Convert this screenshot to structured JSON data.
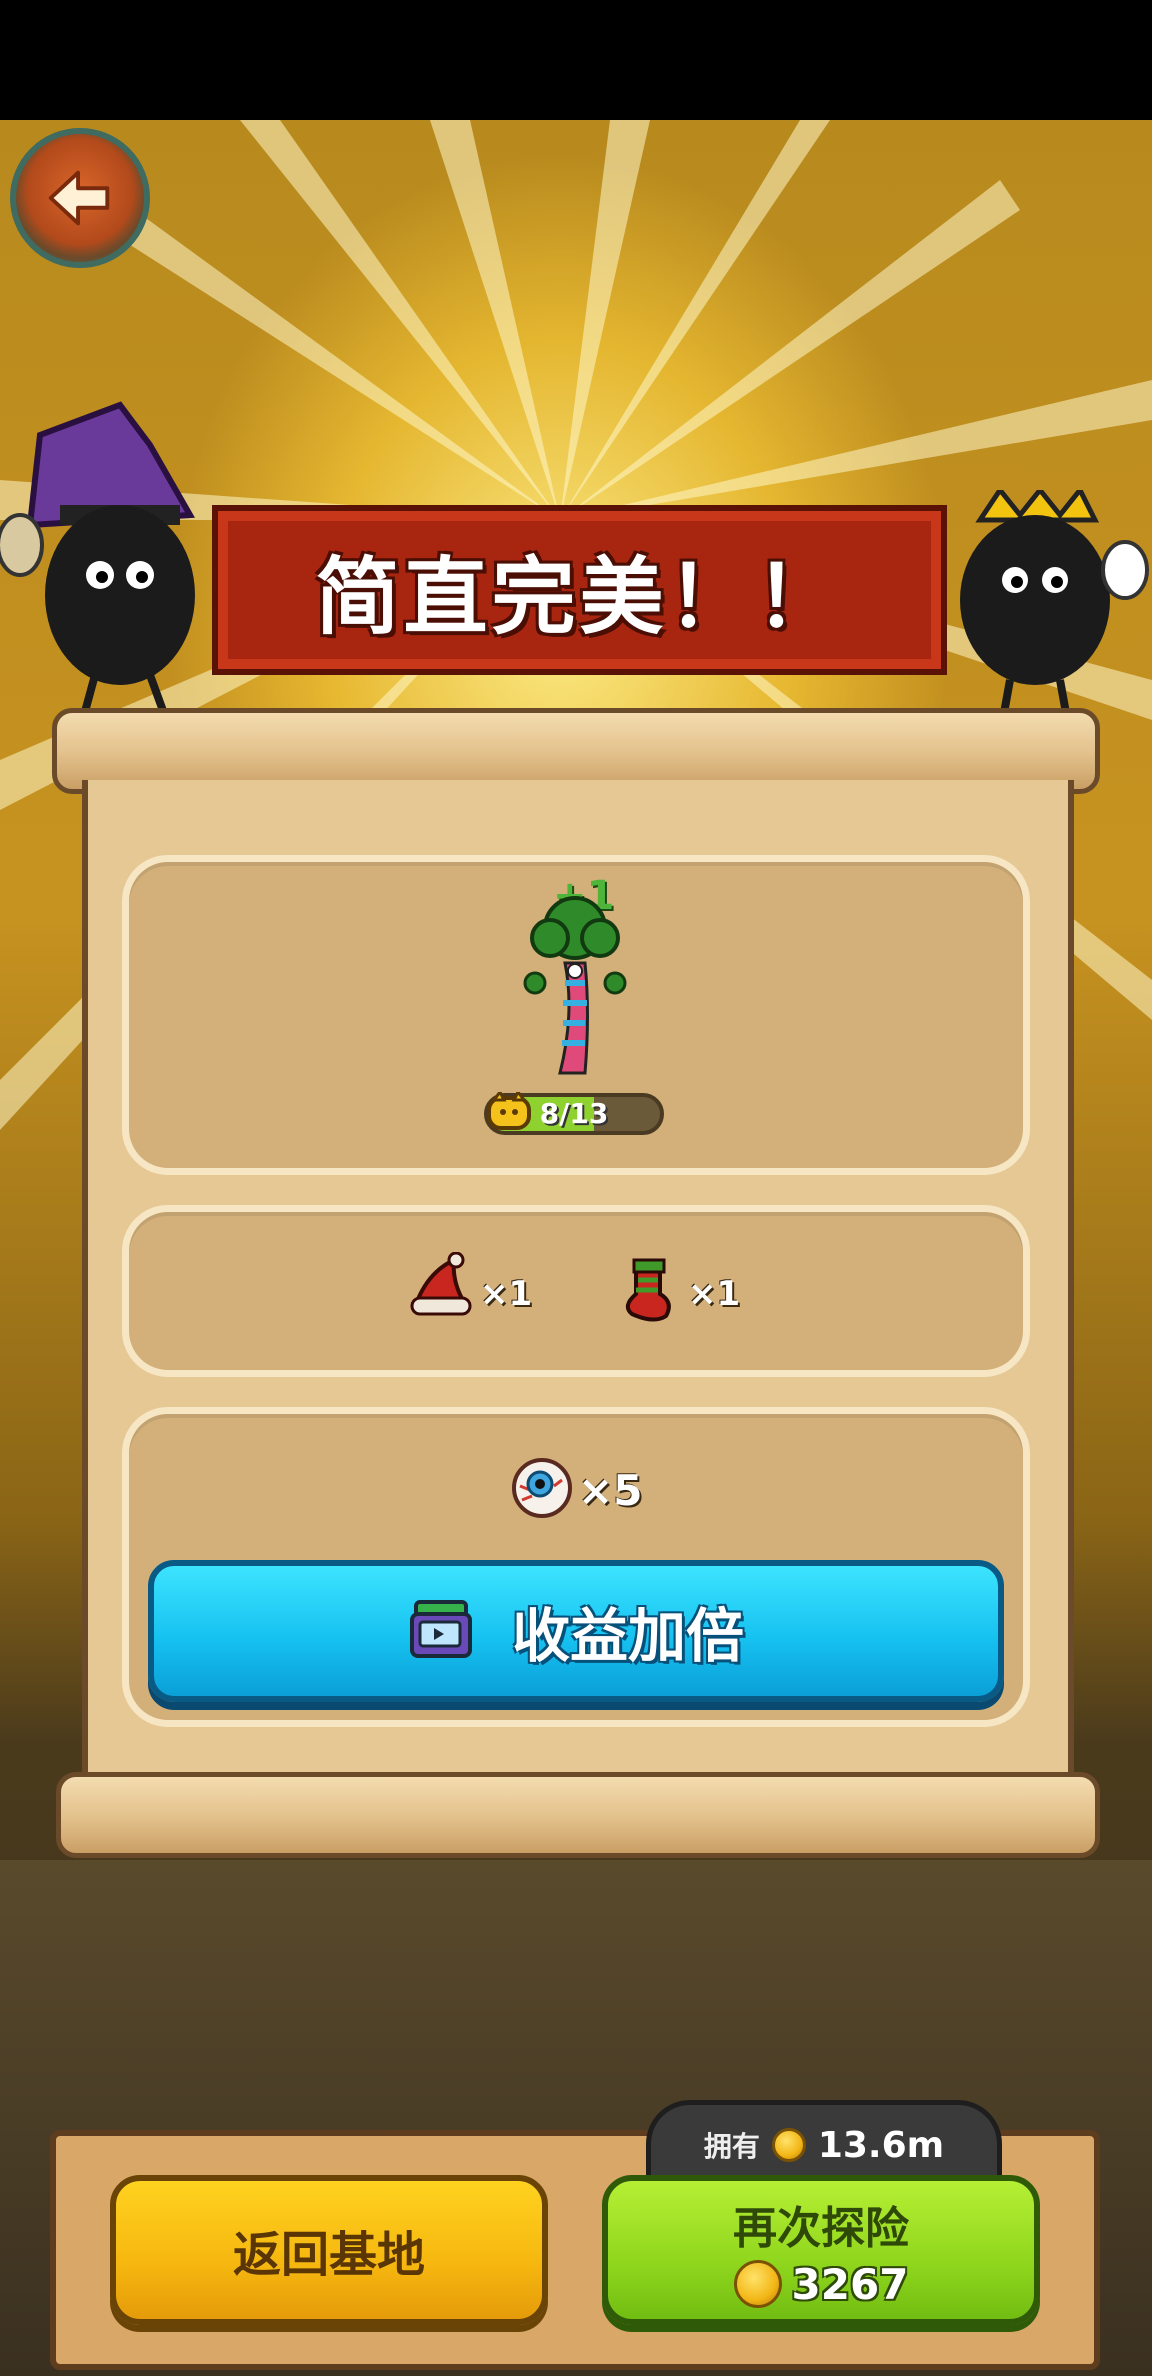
{
  "result": {
    "title": "简直完美！！"
  },
  "monster_reward": {
    "plus": "+1",
    "progress_text": "8/13",
    "progress_value": 8,
    "progress_max": 13
  },
  "item_rewards": [
    {
      "icon": "santa-hat-icon",
      "qty": "×1"
    },
    {
      "icon": "christmas-stocking-icon",
      "qty": "×1"
    }
  ],
  "eyeball_reward": {
    "icon": "eyeball-icon",
    "qty": "×5"
  },
  "double_button": {
    "label": "收益加倍",
    "icon": "tv-ad-icon"
  },
  "bottom": {
    "return_label": "返回基地",
    "explore_label": "再次探险",
    "explore_cost": "3267",
    "owned_label": "拥有",
    "owned_value": "13.6m"
  }
}
